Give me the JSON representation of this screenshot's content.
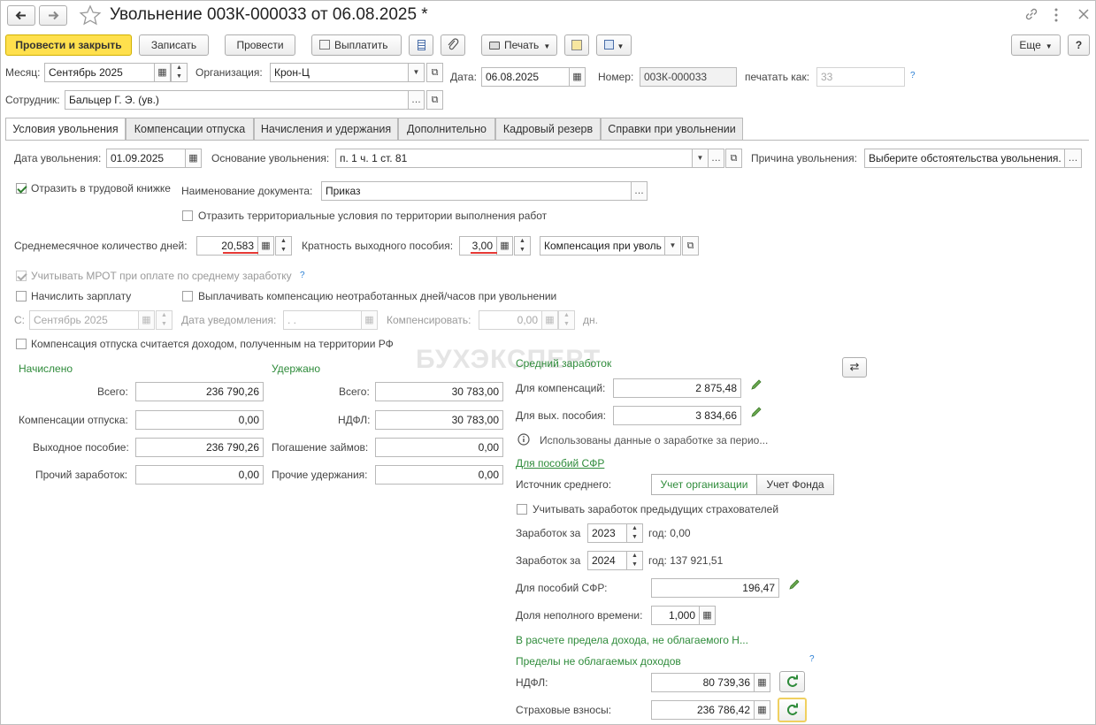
{
  "title": "Увольнение 003К-000033 от 06.08.2025 *",
  "toolbar": {
    "post_close": "Провести и закрыть",
    "save": "Записать",
    "post": "Провести",
    "pay": "Выплатить",
    "print": "Печать",
    "more": "Еще",
    "help": "?"
  },
  "header": {
    "month_label": "Месяц:",
    "month_value": "Сентябрь 2025",
    "org_label": "Организация:",
    "org_value": "Крон-Ц",
    "date_label": "Дата:",
    "date_value": "06.08.2025",
    "number_label": "Номер:",
    "number_value": "003К-000033",
    "print_as_label": "печатать как:",
    "print_as_value": "33",
    "employee_label": "Сотрудник:",
    "employee_value": "Бальцер Г. Э. (ув.)"
  },
  "tabs": [
    "Условия увольнения",
    "Компенсации отпуска",
    "Начисления и удержания",
    "Дополнительно",
    "Кадровый резерв",
    "Справки при увольнении"
  ],
  "conditions": {
    "dismissal_date_label": "Дата увольнения:",
    "dismissal_date_value": "01.09.2025",
    "basis_label": "Основание увольнения:",
    "basis_value": "п. 1 ч. 1 ст. 81",
    "reason_label": "Причина увольнения:",
    "reason_value": "Выберите обстоятельства увольнения.",
    "workbook_label": "Отразить в трудовой книжке",
    "doc_name_label": "Наименование документа:",
    "doc_name_value": "Приказ",
    "territorial_label": "Отразить территориальные условия по территории выполнения работ",
    "avg_days_label": "Среднемесячное количество дней:",
    "avg_days_value": "20,583",
    "severance_mult_label": "Кратность выходного пособия:",
    "severance_mult_value": "3,00",
    "compensation_type": "Компенсация при уволь",
    "mrot_label": "Учитывать МРОТ при оплате по среднему заработку",
    "accrue_salary_label": "Начислить зарплату",
    "pay_unworked_label": "Выплачивать компенсацию неотработанных дней/часов при увольнении",
    "from_label": "С:",
    "from_value": "Сентябрь 2025",
    "notice_date_label": "Дата уведомления:",
    "notice_date_value": " .  .",
    "compensate_label": "Компенсировать:",
    "compensate_value": "0,00",
    "days_unit": "дн.",
    "rf_income_label": "Компенсация отпуска считается доходом, полученным на территории РФ"
  },
  "accrued": {
    "title": "Начислено",
    "rows": [
      {
        "label": "Всего:",
        "value": "236 790,26"
      },
      {
        "label": "Компенсации отпуска:",
        "value": "0,00"
      },
      {
        "label": "Выходное пособие:",
        "value": "236 790,26"
      },
      {
        "label": "Прочий заработок:",
        "value": "0,00"
      }
    ]
  },
  "withheld": {
    "title": "Удержано",
    "rows": [
      {
        "label": "Всего:",
        "value": "30 783,00"
      },
      {
        "label": "НДФЛ:",
        "value": "30 783,00"
      },
      {
        "label": "Погашение займов:",
        "value": "0,00"
      },
      {
        "label": "Прочие удержания:",
        "value": "0,00"
      }
    ]
  },
  "avg_earnings": {
    "title": "Средний заработок",
    "for_comp_label": "Для компенсаций:",
    "for_comp_value": "2 875,48",
    "for_sev_label": "Для вых. пособия:",
    "for_sev_value": "3 834,66",
    "info_text": "Использованы данные о заработке за перио...",
    "sfr_link": "Для пособий СФР",
    "source_label": "Источник среднего:",
    "source_org": "Учет организации",
    "source_fund": "Учет Фонда",
    "prev_insurers_label": "Учитывать заработок предыдущих страхователей",
    "earn_label": "Заработок за",
    "year1": "2023",
    "year1_text": "год: 0,00",
    "year2": "2024",
    "year2_text": "год: 137 921,51",
    "sfr_benefit_label": "Для пособий СФР:",
    "sfr_benefit_value": "196,47",
    "part_time_label": "Доля неполного времени:",
    "part_time_value": "1,000",
    "limit_note": "В расчете предела дохода, не облагаемого Н...",
    "limits_title": "Пределы не облагаемых доходов",
    "ndfl_label": "НДФЛ:",
    "ndfl_value": "80 739,36",
    "insurance_label": "Страховые взносы:",
    "insurance_value": "236 786,42"
  },
  "watermark": "БУХЭКСПЕРТ",
  "colors": {
    "accent_green": "#2e8b3a",
    "yellow_button": "#ffe04d",
    "underline_red": "#e53935"
  }
}
